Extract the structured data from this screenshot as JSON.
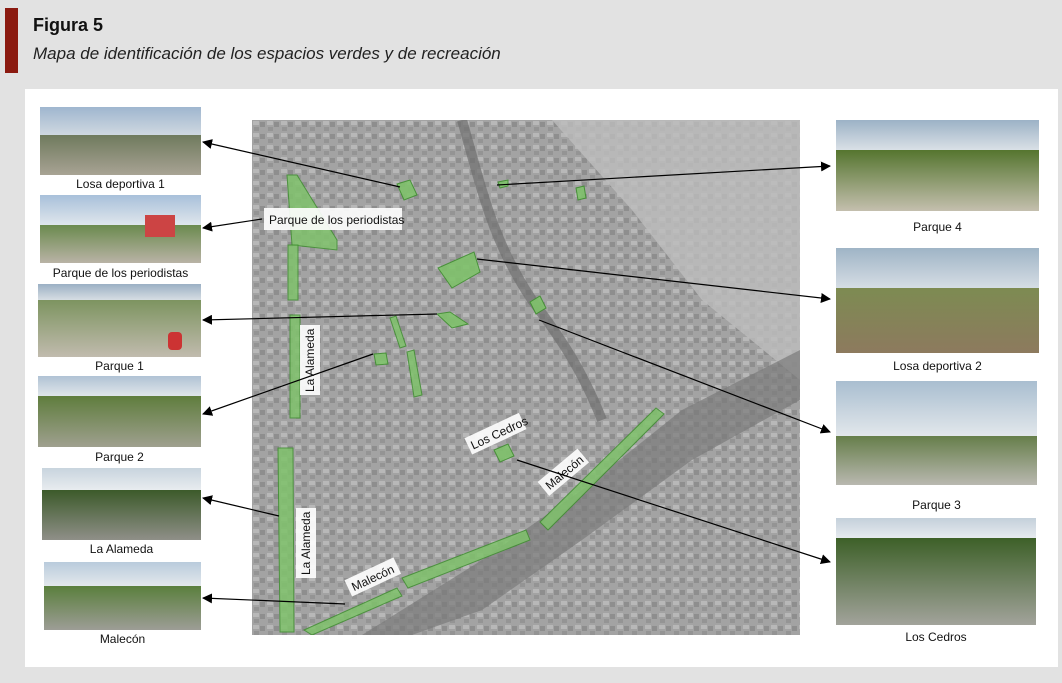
{
  "figure": {
    "label": "Figura 5",
    "title": "Mapa de identificación de los espacios verdes y de recreación"
  },
  "photos": {
    "left": [
      {
        "caption": "Losa deportiva 1"
      },
      {
        "caption": "Parque de los periodistas"
      },
      {
        "caption": "Parque 1"
      },
      {
        "caption": "Parque 2"
      },
      {
        "caption": "La Alameda"
      },
      {
        "caption": "Malecón"
      }
    ],
    "right": [
      {
        "caption": "Parque 4"
      },
      {
        "caption": "Losa deportiva 2"
      },
      {
        "caption": "Parque 3"
      },
      {
        "caption": "Los Cedros"
      }
    ]
  },
  "map_labels": {
    "periodistas": "Parque de los periodistas",
    "alameda_upper": "La Alameda",
    "alameda_lower": "La Alameda",
    "los_cedros": "Los Cedros",
    "malecon_east": "Malecón",
    "malecon_west": "Malecón"
  },
  "colors": {
    "accent": "#8b1a10",
    "green_area": "#7fc26b",
    "green_stroke": "#3f8f2f",
    "map_gray": "#9a9a9a"
  }
}
